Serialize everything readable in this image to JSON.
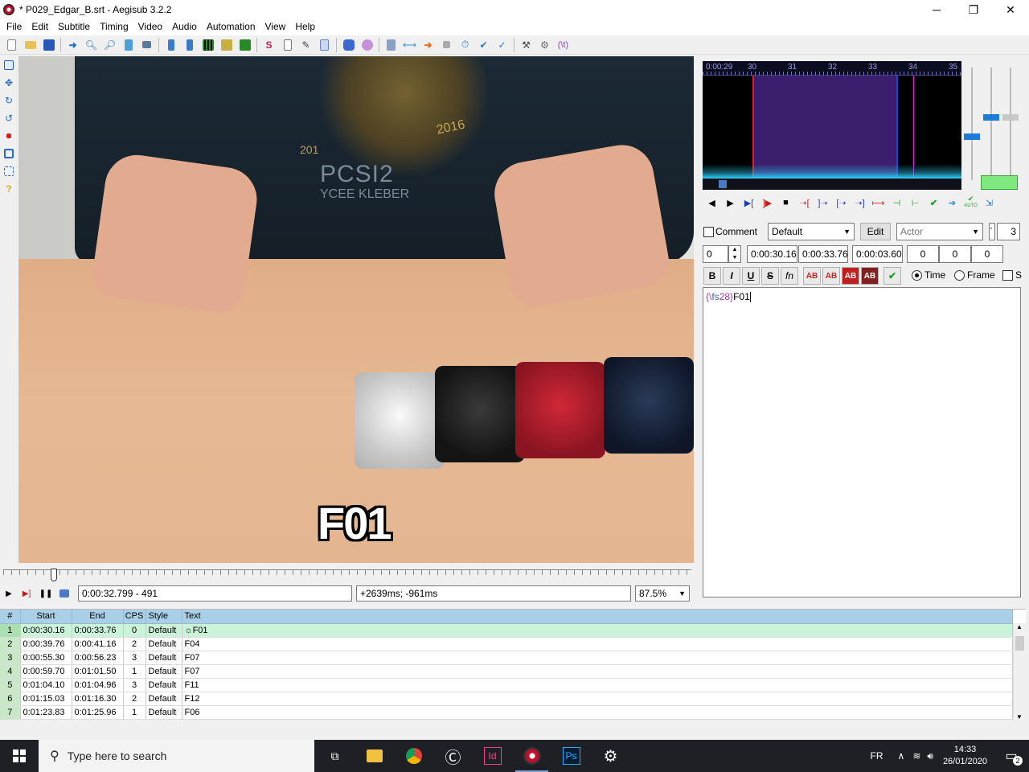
{
  "window": {
    "title": "* P029_Edgar_B.srt - Aegisub 3.2.2",
    "minimize": "─",
    "restore": "❐",
    "close": "✕"
  },
  "menu": [
    "File",
    "Edit",
    "Subtitle",
    "Timing",
    "Video",
    "Audio",
    "Automation",
    "View",
    "Help"
  ],
  "toolbar_icons": [
    "new-file",
    "open-file",
    "save-file",
    "jump-to",
    "zoom-in",
    "zoom-out",
    "video-details",
    "snapshot",
    "pin-start",
    "pin-end",
    "grid",
    "film",
    "film-alt",
    "spell-check",
    "properties",
    "attachments",
    "fonts",
    "automation",
    "kanji",
    "resample",
    "shift-times",
    "translate",
    "stop",
    "clock",
    "timing",
    "tools",
    "options",
    "lua"
  ],
  "video": {
    "subtitle_text": "F01",
    "time_display": "0:00:32.799 - 491",
    "offset_display": "+2639ms; -961ms",
    "zoom": "87.5%",
    "backdrop_text": [
      "2016",
      "201",
      "PCSI2",
      "YCEE KLEBER"
    ]
  },
  "audio": {
    "ruler_labels": [
      "0:00:29",
      "30",
      "31",
      "32",
      "33",
      "34",
      "35"
    ],
    "auto_label": "AUTO"
  },
  "edit": {
    "comment_label": "Comment",
    "style": "Default",
    "edit_button": "Edit",
    "actor_placeholder": "Actor",
    "effect_tail": "ˊ",
    "layer_count": "3",
    "layer": "0",
    "start": "0:00:30.16",
    "end": "0:00:33.76",
    "duration": "0:00:03.60",
    "margin_l": "0",
    "margin_r": "0",
    "margin_v": "0",
    "bold": "B",
    "italic": "I",
    "underline": "U",
    "strike": "S",
    "fn": "fn",
    "ab": "AB",
    "time_label": "Time",
    "frame_label": "Frame",
    "s_label": "S",
    "text_tag_open": "{\\",
    "text_tag_name": "fs",
    "text_tag_value": "28",
    "text_tag_close": "}",
    "text_body": "F01"
  },
  "grid": {
    "headers": [
      "#",
      "Start",
      "End",
      "CPS",
      "Style",
      "Text"
    ],
    "rows": [
      {
        "n": "1",
        "start": "0:00:30.16",
        "end": "0:00:33.76",
        "cps": "0",
        "style": "Default",
        "text": "☼F01"
      },
      {
        "n": "2",
        "start": "0:00:39.76",
        "end": "0:00:41.16",
        "cps": "2",
        "style": "Default",
        "text": "F04"
      },
      {
        "n": "3",
        "start": "0:00:55.30",
        "end": "0:00:56.23",
        "cps": "3",
        "style": "Default",
        "text": "F07"
      },
      {
        "n": "4",
        "start": "0:00:59.70",
        "end": "0:01:01.50",
        "cps": "1",
        "style": "Default",
        "text": "F07"
      },
      {
        "n": "5",
        "start": "0:01:04.10",
        "end": "0:01:04.96",
        "cps": "3",
        "style": "Default",
        "text": "F11"
      },
      {
        "n": "6",
        "start": "0:01:15.03",
        "end": "0:01:16.30",
        "cps": "2",
        "style": "Default",
        "text": "F12"
      },
      {
        "n": "7",
        "start": "0:01:23.83",
        "end": "0:01:25.96",
        "cps": "1",
        "style": "Default",
        "text": "F06"
      }
    ]
  },
  "taskbar": {
    "search_placeholder": "Type here to search",
    "lang": "FR",
    "time": "14:33",
    "date": "26/01/2020",
    "notifications": "2"
  },
  "colors": {
    "grid_header": "#aad0e8",
    "active_row": "#cbf3d9",
    "audio_selection": "#3b1f6e"
  }
}
